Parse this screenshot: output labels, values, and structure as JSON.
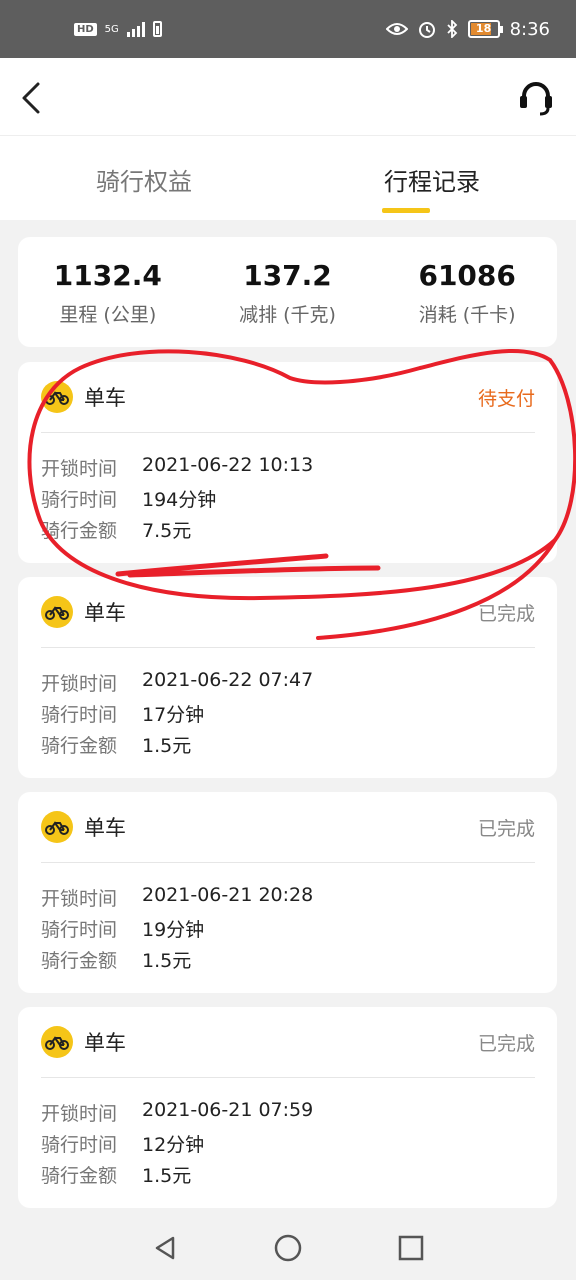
{
  "status_bar": {
    "hd": "HD",
    "network": "5G",
    "time": "8:36",
    "battery": "18"
  },
  "tabs": [
    {
      "label": "骑行权益",
      "active": false
    },
    {
      "label": "行程记录",
      "active": true
    }
  ],
  "stats": [
    {
      "value": "1132.4",
      "label": "里程 (公里)"
    },
    {
      "value": "137.2",
      "label": "减排 (千克)"
    },
    {
      "value": "61086",
      "label": "消耗 (千卡)"
    }
  ],
  "trips": [
    {
      "type": "单车",
      "status": "待支付",
      "unlock_label": "开锁时间",
      "unlock_time": "2021-06-22 10:13",
      "duration_label": "骑行时间",
      "duration": "194分钟",
      "amount_label": "骑行金额",
      "amount": "7.5元"
    },
    {
      "type": "单车",
      "status": "已完成",
      "unlock_label": "开锁时间",
      "unlock_time": "2021-06-22 07:47",
      "duration_label": "骑行时间",
      "duration": "17分钟",
      "amount_label": "骑行金额",
      "amount": "1.5元"
    },
    {
      "type": "单车",
      "status": "已完成",
      "unlock_label": "开锁时间",
      "unlock_time": "2021-06-21 20:28",
      "duration_label": "骑行时间",
      "duration": "19分钟",
      "amount_label": "骑行金额",
      "amount": "1.5元"
    },
    {
      "type": "单车",
      "status": "已完成",
      "unlock_label": "开锁时间",
      "unlock_time": "2021-06-21 07:59",
      "duration_label": "骑行时间",
      "duration": "12分钟",
      "amount_label": "骑行金额",
      "amount": "1.5元"
    }
  ],
  "colors": {
    "accent": "#f5c518",
    "pending": "#e86a1c",
    "annotation": "#e8202a"
  },
  "icons": [
    "back-icon",
    "customer-service-icon",
    "bike-icon",
    "nav-back-icon",
    "nav-home-icon",
    "nav-recents-icon"
  ]
}
